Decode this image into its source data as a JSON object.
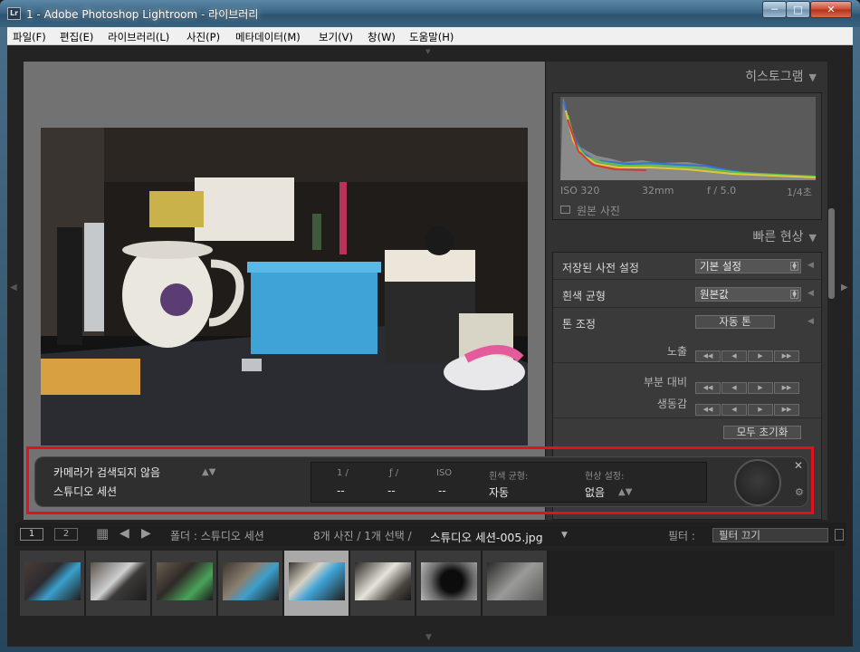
{
  "window": {
    "app_icon": "Lr",
    "title": "1 - Adobe Photoshop Lightroom - 라이브러리",
    "minimize": "─",
    "maximize": "□",
    "close": "✕"
  },
  "menu": [
    "파일(F)",
    "편집(E)",
    "라이브러리(L)",
    "사진(P)",
    "메타데이터(M)",
    "보기(V)",
    "창(W)",
    "도움말(H)"
  ],
  "histogram": {
    "title": "히스토그램",
    "iso": "ISO 320",
    "focal": "32mm",
    "aperture": "f / 5.0",
    "shutter": "1/4초",
    "original_photo": "원본 사진"
  },
  "quick_develop": {
    "title": "빠른 현상",
    "saved_preset_label": "저장된 사전 설정",
    "saved_preset_value": "기본 설정",
    "white_balance_label": "흰색 균형",
    "white_balance_value": "원본값",
    "tone_label": "톤 조정",
    "auto_tone": "자동 톤",
    "exposure": "노출",
    "clarity": "부분 대비",
    "vibrance": "생동감",
    "reset_all": "모두 초기화"
  },
  "tether": {
    "camera": "카메라가 검색되지 않음",
    "session": "스튜디오 세션",
    "shutter_label": "1 /",
    "aperture_label": "ƒ /",
    "iso_label": "ISO",
    "shutter_value": "--",
    "aperture_value": "--",
    "iso_value": "--",
    "wb_label": "흰색 균형:",
    "wb_value": "자동",
    "develop_label": "현상 설정:",
    "develop_value": "없음",
    "close": "✕",
    "gear": "⚙"
  },
  "filmstrip_header": {
    "view1": "1",
    "view2": "2",
    "folder_label": "폴더 : 스튜디오 세션",
    "counts": "8개 사진 / 1개 선택 /",
    "filename": "스튜디오 세션-005.jpg",
    "filter_label": "필터 :",
    "filter_value": "필터 끄기"
  },
  "filmstrip": {
    "selected_index": 4,
    "count": 8
  },
  "colors": {
    "accent_outline": "#e4111b",
    "panel": "#323232",
    "background": "#232323"
  }
}
